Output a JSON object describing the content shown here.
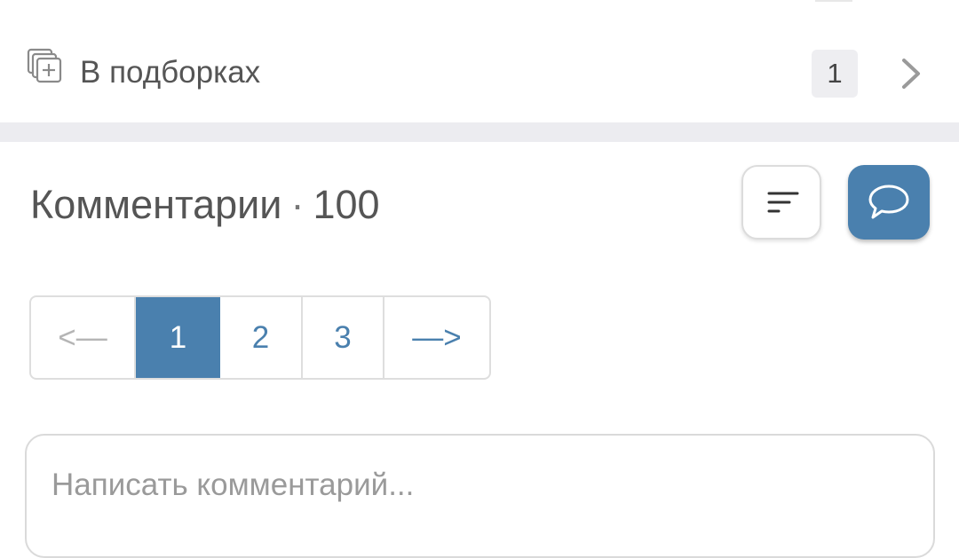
{
  "collections": {
    "label": "В подборках",
    "count": "1",
    "icon": "collections-add-icon"
  },
  "comments": {
    "title": "Комментарии",
    "separator": "·",
    "count": "100",
    "sort_icon": "sort-icon",
    "write_icon": "speech-bubble-icon"
  },
  "pagination": {
    "prev": "<—",
    "pages": [
      "1",
      "2",
      "3"
    ],
    "current": "1",
    "next": "—>"
  },
  "comment_input": {
    "placeholder": "Написать комментарий..."
  },
  "colors": {
    "accent": "#4a80ae",
    "divider": "#ececf0",
    "badge_bg": "#eeeef1"
  }
}
